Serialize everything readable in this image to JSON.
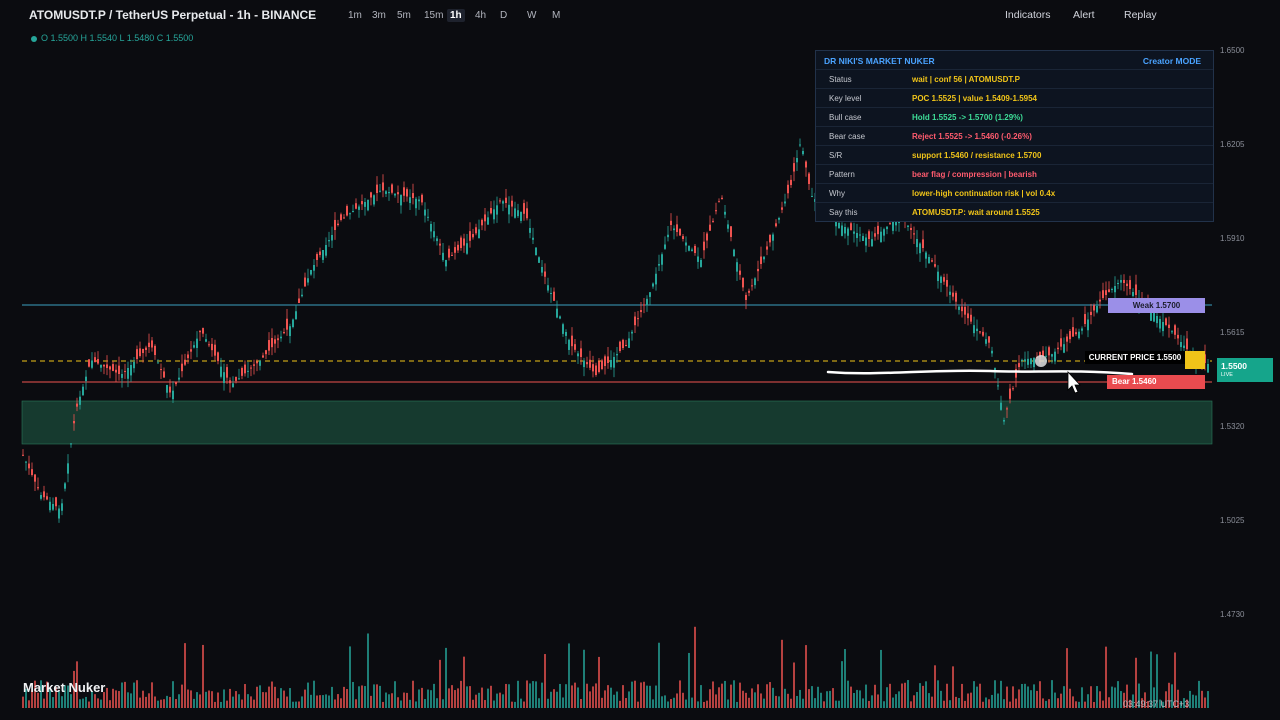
{
  "header": {
    "symbol": "ATOMUSDT.P / TetherUS Perpetual - 1h - BINANCE",
    "timeframes": [
      "1m",
      "3m",
      "5m",
      "15m",
      "1h",
      "4h",
      "D",
      "W",
      "M"
    ],
    "active_timeframe": "1h",
    "buttons": [
      "Indicators",
      "Alert",
      "Replay"
    ],
    "ohlc": "O 1.5500 H 1.5540 L 1.5480 C 1.5500"
  },
  "price_axis": [
    "1.6500",
    "1.6205",
    "1.5910",
    "1.5615",
    "1.5320",
    "1.5025",
    "1.4730"
  ],
  "panel": {
    "title": "DR NIKI'S MARKET NUKER",
    "mode": "Creator MODE",
    "rows": [
      {
        "k": "Status",
        "v": "wait | conf 56 | ATOMUSDT.P",
        "color": "#f0c419"
      },
      {
        "k": "Key level",
        "v": "POC 1.5525 | value 1.5409-1.5954",
        "color": "#f0c419"
      },
      {
        "k": "Bull case",
        "v": "Hold 1.5525 -> 1.5700 (1.29%)",
        "color": "#3ddc97"
      },
      {
        "k": "Bear case",
        "v": "Reject 1.5525 -> 1.5460 (-0.26%)",
        "color": "#ff5b6e"
      },
      {
        "k": "S/R",
        "v": "support 1.5460 / resistance 1.5700",
        "color": "#f0c419"
      },
      {
        "k": "Pattern",
        "v": "bear flag / compression | bearish",
        "color": "#ff5b6e"
      },
      {
        "k": "Why",
        "v": "lower-high continuation risk | vol 0.4x",
        "color": "#f0c419"
      },
      {
        "k": "Say this",
        "v": "ATOMUSDT.P: wait around 1.5525",
        "color": "#f0c419"
      }
    ]
  },
  "tags": {
    "weak": "Weak 1.5700",
    "current": "CURRENT PRICE 1.5500",
    "bear": "Bear 1.5460"
  },
  "price_label": {
    "price": "1.5500",
    "sub": "LIVE"
  },
  "watermark": "Market Nuker",
  "clock": "03:49:37 UTC+3",
  "colors": {
    "up": "#26a69a",
    "down": "#ef5350",
    "zone": "#1e5a44",
    "resistance": "#3b9fc0",
    "support": "#ef5350",
    "current": "#f0c419"
  }
}
